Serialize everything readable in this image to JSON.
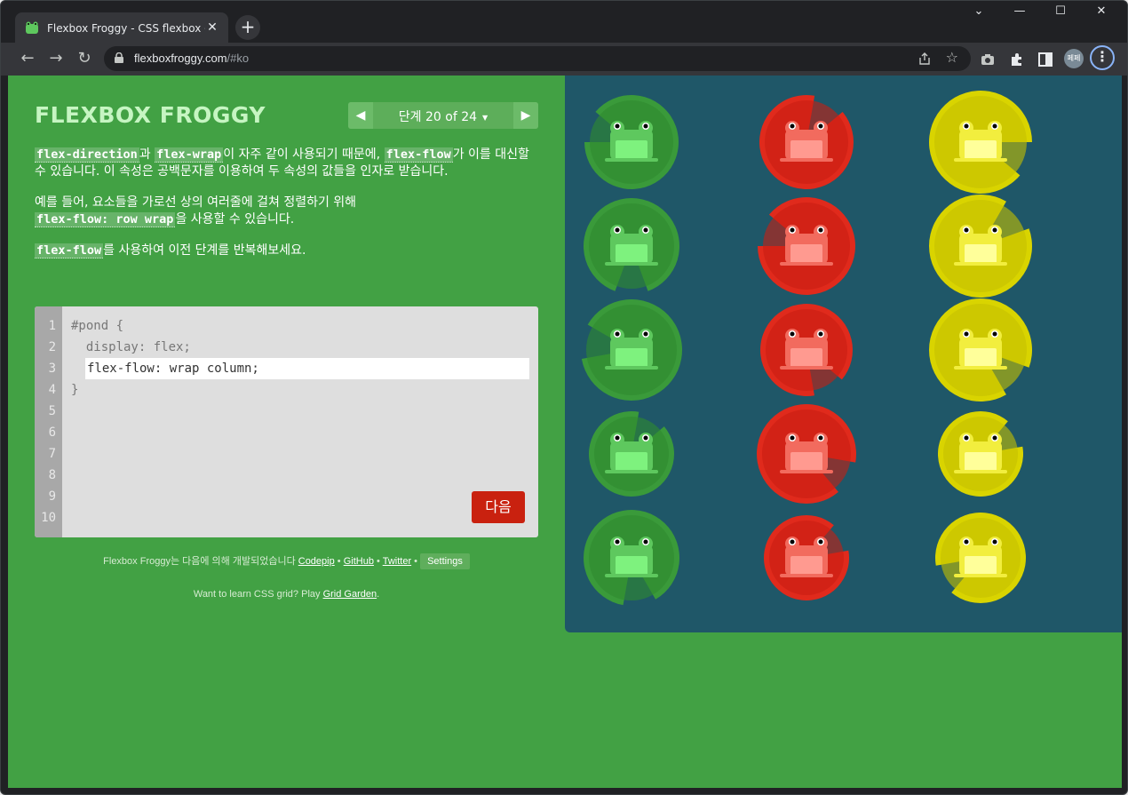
{
  "browser": {
    "tab_title": "Flexbox Froggy - CSS flexbox 속",
    "tab_close": "✕",
    "new_tab": "+",
    "url_host": "flexboxfroggy.com",
    "url_path": "/#ko",
    "profile": "페페",
    "window_controls": [
      "⌄",
      "—",
      "☐",
      "✕"
    ]
  },
  "game": {
    "logo": "FLEXBOX FROGGY",
    "level_label": "단계 20 of 24",
    "level_prev": "◀",
    "level_next": "▶",
    "instructions": {
      "p1_code1": "flex-direction",
      "p1_t1": "과 ",
      "p1_code2": "flex-wrap",
      "p1_t2": "이 자주 같이 사용되기 때문에, ",
      "p1_code3": "flex-flow",
      "p1_t3": "가 이를 대신할 수 있습니다. 이 속성은 공백문자를 이용하여 두 속성의 값들을 인자로 받습니다.",
      "p2_t1": "예를 들어, 요소들을 가로선 상의 여러줄에 걸쳐 정렬하기 위해",
      "p2_code": "flex-flow: row wrap",
      "p2_t2": "을 사용할 수 있습니다.",
      "p3_code": "flex-flow",
      "p3_t1": "를 사용하여 이전 단계를 반복해보세요."
    },
    "editor": {
      "line_numbers": [
        "1",
        "2",
        "3",
        "4",
        "5",
        "6",
        "7",
        "8",
        "9",
        "10"
      ],
      "line1": "#pond {",
      "line2": "  display: flex;",
      "input_value": "flex-flow: wrap column;",
      "line4": "}",
      "next_button": "다음"
    },
    "credits": {
      "text": "Flexbox Froggy는 다음에 의해 개발되었습니다 ",
      "codepip": "Codepip",
      "github": "GitHub",
      "twitter": "Twitter",
      "sep": " • ",
      "settings": "Settings"
    },
    "grid_garden": {
      "text": "Want to learn CSS grid? Play ",
      "link": "Grid Garden",
      "end": "."
    },
    "pond": {
      "columns": [
        {
          "color": "green",
          "pad": "#3a9a3a",
          "pad_dark": "#2e8a2e",
          "frog": "#5ec85e",
          "belly": "#7ef27e"
        },
        {
          "color": "red",
          "pad": "#e02a1c",
          "pad_dark": "#c81e12",
          "frog": "#f26b5e",
          "belly": "#ff9a90"
        },
        {
          "color": "yellow",
          "pad": "#d9d400",
          "pad_dark": "#c4c000",
          "frog": "#f2ee3e",
          "belly": "#ffff9a"
        }
      ]
    }
  }
}
